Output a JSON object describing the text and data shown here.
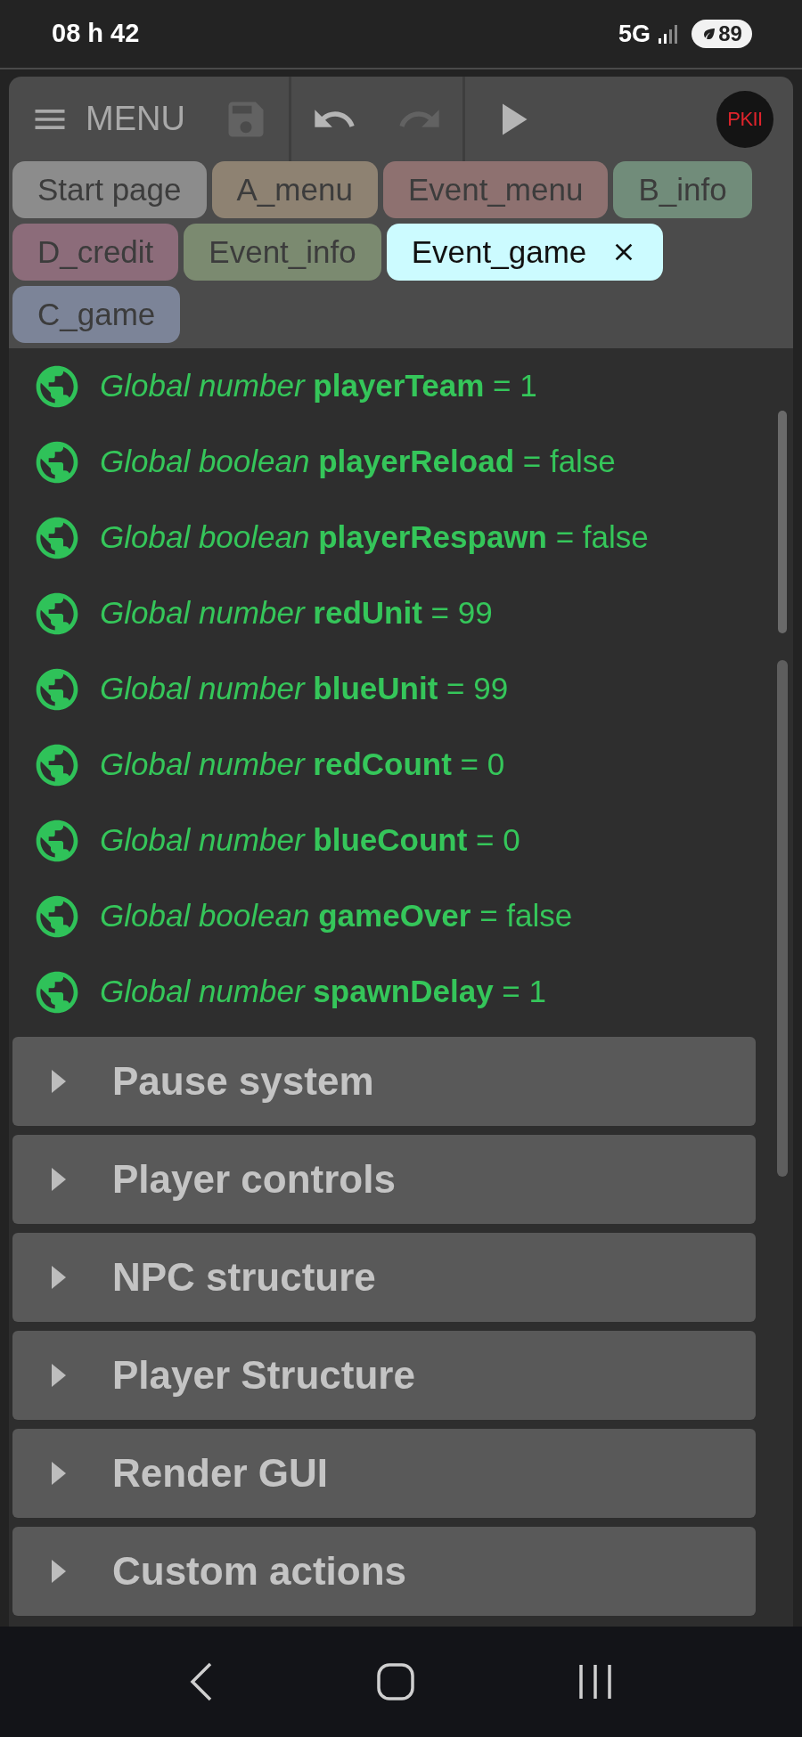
{
  "status_bar": {
    "time": "08 h 42",
    "network": "5G",
    "battery": "89"
  },
  "toolbar": {
    "menu_label": "MENU",
    "actions": [
      {
        "kind": "save",
        "disabled": true
      },
      {
        "kind": "undo",
        "disabled": false
      },
      {
        "kind": "redo",
        "disabled": true
      },
      {
        "kind": "play",
        "disabled": false
      }
    ],
    "logo_text": "PKII"
  },
  "tabs": [
    {
      "label": "Start page",
      "color": "#8c8c8c",
      "selected": false
    },
    {
      "label": "A_menu",
      "color": "#8e8272",
      "selected": false
    },
    {
      "label": "Event_menu",
      "color": "#8e7170",
      "selected": false
    },
    {
      "label": "B_info",
      "color": "#718c7a",
      "selected": false
    },
    {
      "label": "D_credit",
      "color": "#8c6c7a",
      "selected": false
    },
    {
      "label": "Event_info",
      "color": "#7b8a70",
      "selected": false
    },
    {
      "label": "Event_game",
      "color": "#ccfbff",
      "selected": true
    },
    {
      "label": "C_game",
      "color": "#7c8498",
      "selected": false
    }
  ],
  "variables": [
    {
      "text": "*Global number* **playerTeam** = 1"
    },
    {
      "text": "*Global boolean* **playerReload** = false"
    },
    {
      "text": "*Global boolean* **playerRespawn** = false"
    },
    {
      "text": "*Global number* **redUnit** = 99"
    },
    {
      "text": "*Global number* **blueUnit** = 99"
    },
    {
      "text": "*Global number* **redCount** = 0"
    },
    {
      "text": "*Global number* **blueCount** = 0"
    },
    {
      "text": "*Global boolean* **gameOver** = false"
    },
    {
      "text": "*Global number* **spawnDelay** = 1"
    }
  ],
  "sections": [
    {
      "label": "Pause system",
      "expanded": false
    },
    {
      "label": "Player controls",
      "expanded": false
    },
    {
      "label": "NPC structure",
      "expanded": false
    },
    {
      "label": "Player Structure",
      "expanded": false
    },
    {
      "label": "Render GUI",
      "expanded": false
    },
    {
      "label": "Custom actions",
      "expanded": false
    }
  ]
}
